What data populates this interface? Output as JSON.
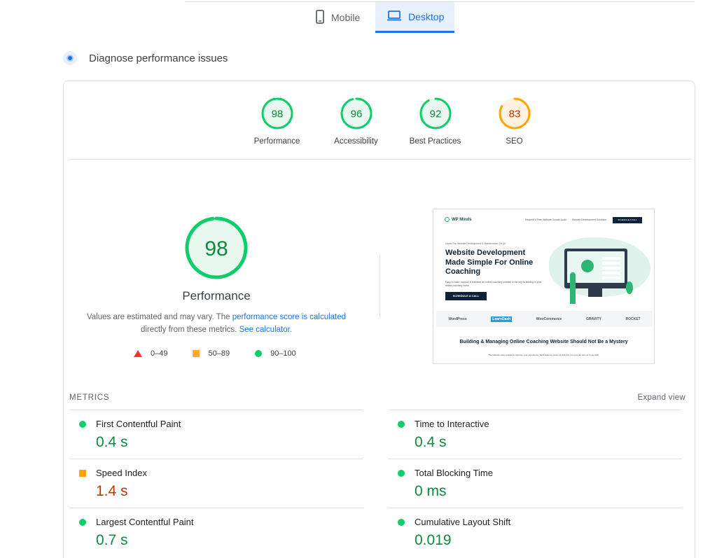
{
  "tabs": [
    {
      "label": "Mobile",
      "icon": "phone-icon",
      "active": false
    },
    {
      "label": "Desktop",
      "icon": "laptop-icon",
      "active": true
    }
  ],
  "diagnose": {
    "title": "Diagnose performance issues"
  },
  "colors": {
    "pass": "#0cce6b",
    "average": "#ffa400",
    "fail": "#ff3333",
    "accent": "#1a73e8"
  },
  "scores": [
    {
      "label": "Performance",
      "value": "98",
      "status": "pass"
    },
    {
      "label": "Accessibility",
      "value": "96",
      "status": "pass"
    },
    {
      "label": "Best Practices",
      "value": "92",
      "status": "pass"
    },
    {
      "label": "SEO",
      "value": "83",
      "status": "average"
    }
  ],
  "performance": {
    "score": "98",
    "title": "Performance",
    "note_prefix": "Values are estimated and may vary. The ",
    "note_link": "performance score is calculated",
    "note_middle": " directly from these metrics. ",
    "calc_link": "See calculator.",
    "legend": [
      {
        "range": "0–49",
        "shape": "triangle"
      },
      {
        "range": "50–89",
        "shape": "square"
      },
      {
        "range": "90–100",
        "shape": "circle"
      }
    ]
  },
  "thumbnail": {
    "logo": "WP Minds",
    "nav_links": [
      "Request A Free Website Growth Audit",
      "Website Development Solutions"
    ],
    "nav_cta": "SCHEDULE A CALL",
    "pretitle": "Learn The Website Development & Maintenance On Us",
    "heading": "Website Development Made Simple For Online Coaching",
    "paragraph": "Easy to build, support & maintain an online coaching website is the key to leading in your online coaching niche.",
    "button": "SCHEDULE A CALL",
    "brands": [
      "WordPress",
      "LearnDash",
      "WooCommerce",
      "GRAVITY",
      "ROCKET"
    ],
    "subheading": "Building & Managing Online Coaching Website Should Not Be a Mystery",
    "cookie": "This website uses cookies to improve your experience. We'll assume you're ok with this, but you can opt-out if you wish."
  },
  "metrics": {
    "heading": "METRICS",
    "expand": "Expand view",
    "left": [
      {
        "label": "First Contentful Paint",
        "value": "0.4 s",
        "status": "green"
      },
      {
        "label": "Speed Index",
        "value": "1.4 s",
        "status": "orange"
      },
      {
        "label": "Largest Contentful Paint",
        "value": "0.7 s",
        "status": "green"
      }
    ],
    "right": [
      {
        "label": "Time to Interactive",
        "value": "0.4 s",
        "status": "green"
      },
      {
        "label": "Total Blocking Time",
        "value": "0 ms",
        "status": "green"
      },
      {
        "label": "Cumulative Layout Shift",
        "value": "0.019",
        "status": "green"
      }
    ]
  }
}
